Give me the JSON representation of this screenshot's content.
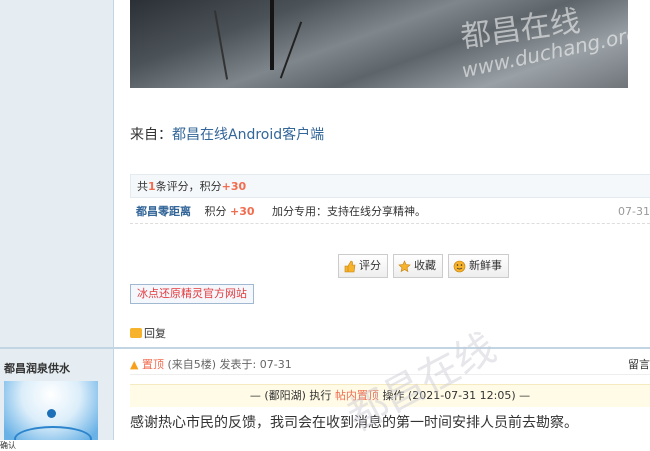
{
  "photo": {
    "watermark_cn": "都昌在线",
    "watermark_url": "www.duchang.org"
  },
  "source": {
    "prefix": "来自：",
    "link": "都昌在线Android客户端"
  },
  "rating": {
    "head_pre": "共",
    "count": "1",
    "head_mid": "条评分，积分",
    "total": "+30",
    "row": {
      "user": "都昌零距离",
      "score_label": "积分",
      "score": "+30",
      "reason": "加分专用：支持在线分享精神。",
      "time": "07-31"
    }
  },
  "buttons": {
    "rate": "评分",
    "favorite": "收藏",
    "fresh": "新鲜事"
  },
  "link_box": "冰点还原精灵官方网站",
  "reply": "回复",
  "next_post": {
    "author": "都昌润泉供水",
    "top_label": "置顶",
    "floor_info": "(来自5楼) 发表于: 07-31",
    "message_btn": "留言",
    "notice_pre": "— (鄱阳湖) 执行",
    "notice_action": "帖内置顶",
    "notice_post": "操作 (2021-07-31 12:05) —",
    "body": "感谢热心市民的反馈，我司会在收到消息的第一时间安排人员前去勘察。",
    "watermark": "都昌在线"
  },
  "bottom_text": "确认"
}
